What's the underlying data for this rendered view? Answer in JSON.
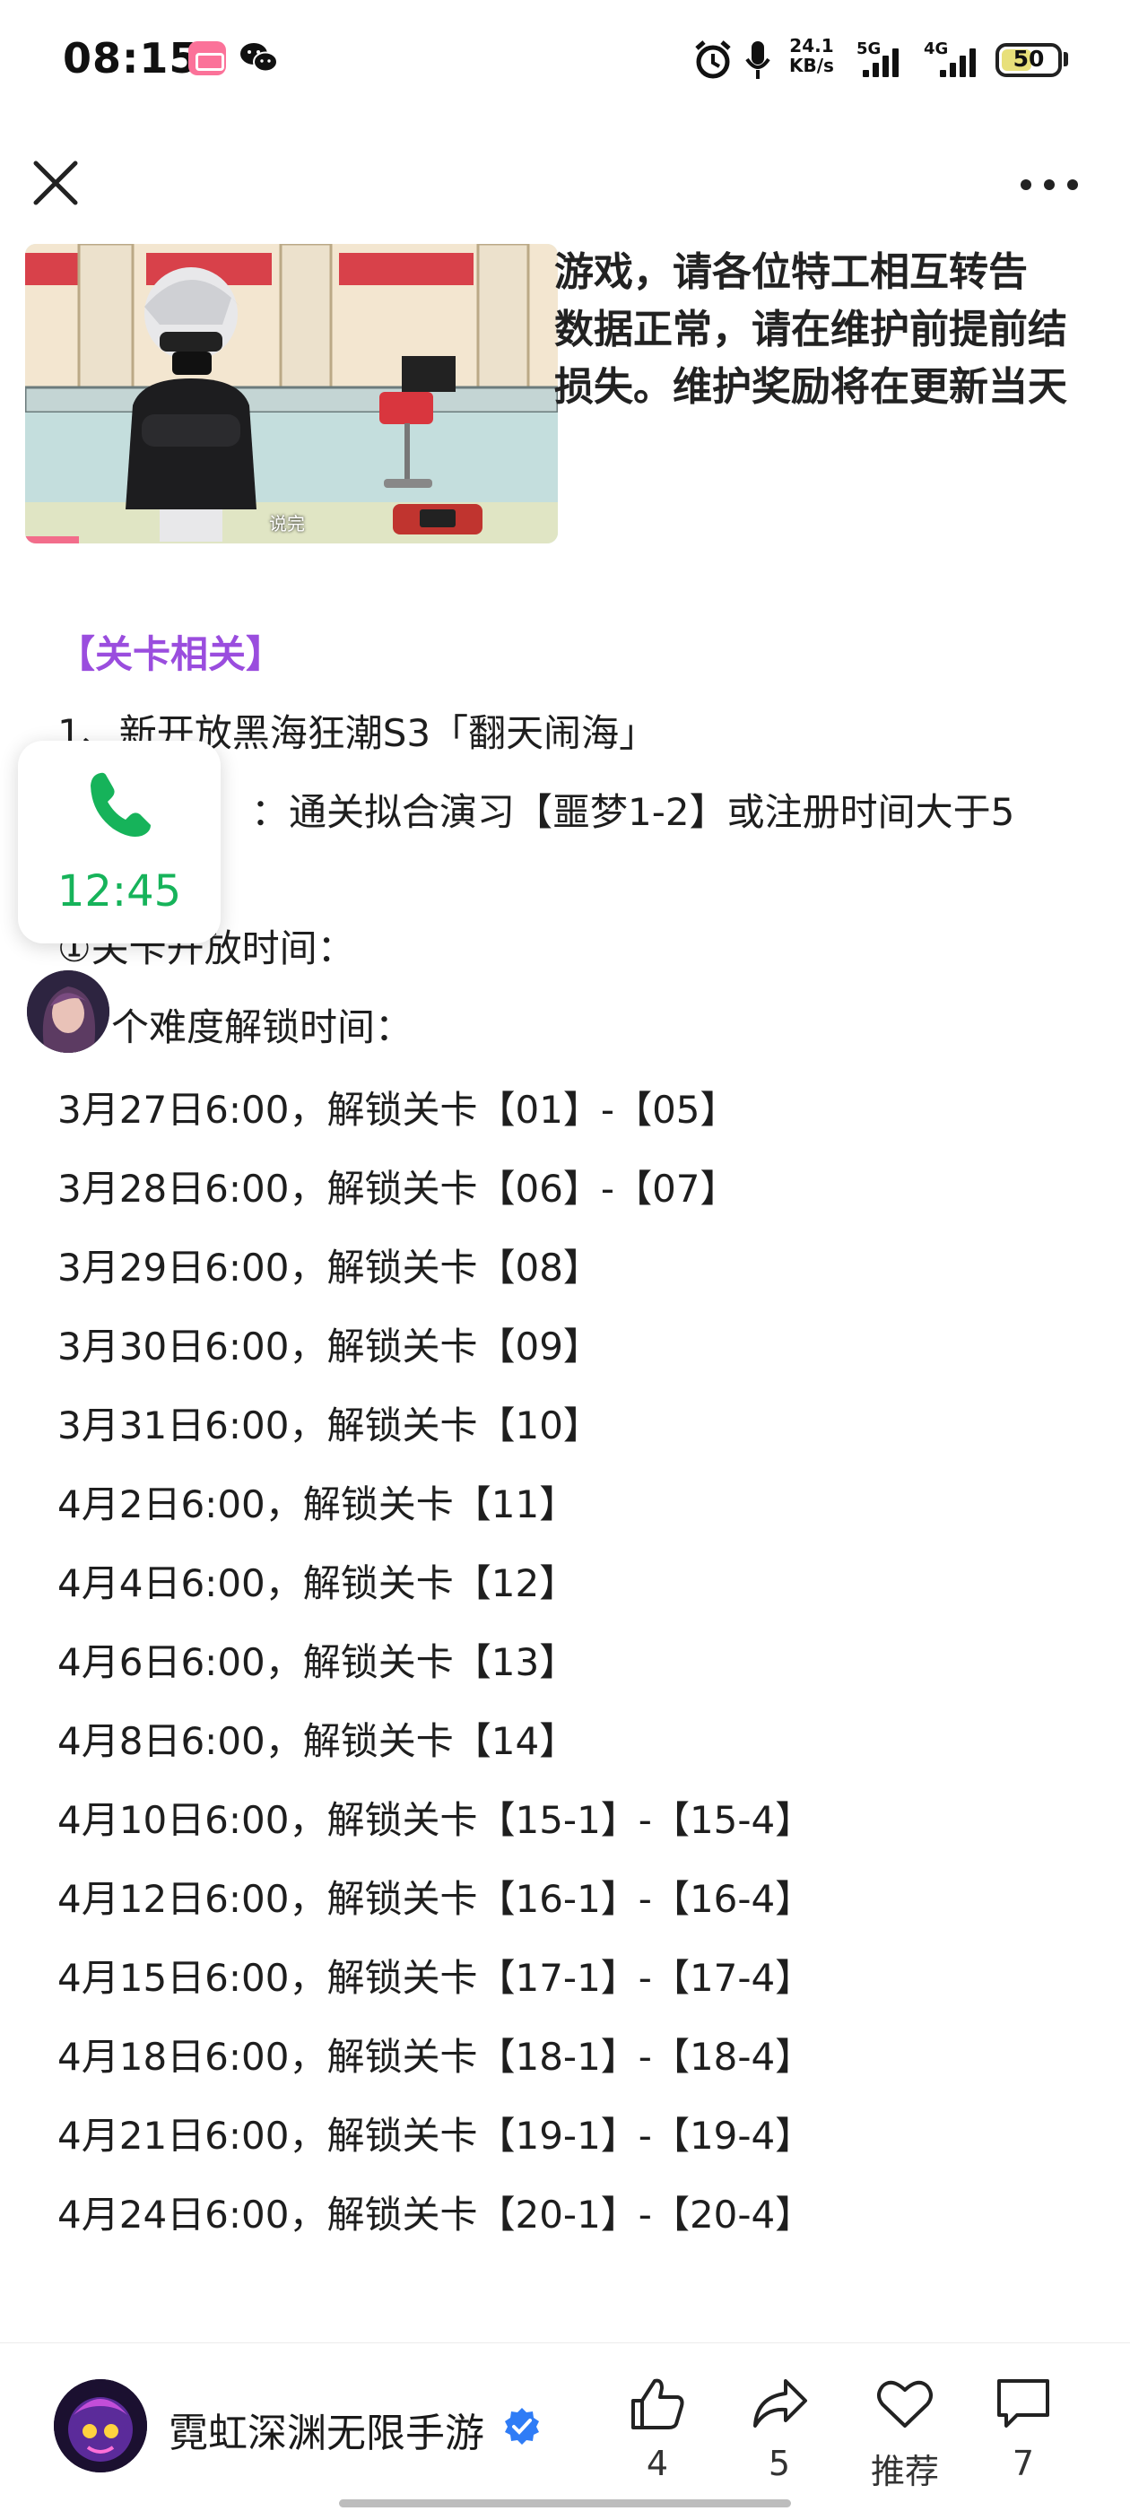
{
  "status_bar": {
    "time": "08:15",
    "net_speed_value": "24.1",
    "net_speed_unit": "KB/s",
    "signal_1": "5G",
    "signal_2": "4G",
    "battery": "50"
  },
  "article": {
    "intro_lines": [
      "游戏，请各位特工相互转告",
      "数据正常，请在维护前提前结",
      "损失。维护奖励将在更新当天"
    ],
    "cover_caption": "说完",
    "section_title": "【关卡相关】",
    "item_1": "1、新开放黑海狂潮S3「翻天闹海」",
    "item_1_condition": "：通关拟合演习【噩梦1-2】或注册时间大于5",
    "item_1_open_time": "①关卡开放时间：",
    "item_1_difficulty": "个难度解锁时间：",
    "schedule": [
      "3月27日6:00，解锁关卡【01】-【05】",
      "3月28日6:00，解锁关卡【06】-【07】",
      "3月29日6:00，解锁关卡【08】",
      "3月30日6:00，解锁关卡【09】",
      "3月31日6:00，解锁关卡【10】",
      "4月2日6:00，解锁关卡【11】",
      "4月4日6:00，解锁关卡【12】",
      "4月6日6:00，解锁关卡【13】",
      "4月8日6:00，解锁关卡【14】",
      "4月10日6:00，解锁关卡【15-1】-【15-4】",
      "4月12日6:00，解锁关卡【16-1】-【16-4】",
      "4月15日6:00，解锁关卡【17-1】-【17-4】",
      "4月18日6:00，解锁关卡【18-1】-【18-4】",
      "4月21日6:00，解锁关卡【19-1】-【19-4】",
      "4月24日6:00，解锁关卡【20-1】-【20-4】"
    ]
  },
  "call_overlay": {
    "timer": "12:45",
    "icon": "phone-icon",
    "color": "#16b35a"
  },
  "bottom_bar": {
    "author": "霓虹深渊无限手游",
    "likes": "4",
    "shares": "5",
    "recommend_label": "推荐",
    "comments": "7"
  },
  "colors": {
    "section_title": "#9a4dde",
    "verified_badge": "#2f7cf6"
  }
}
